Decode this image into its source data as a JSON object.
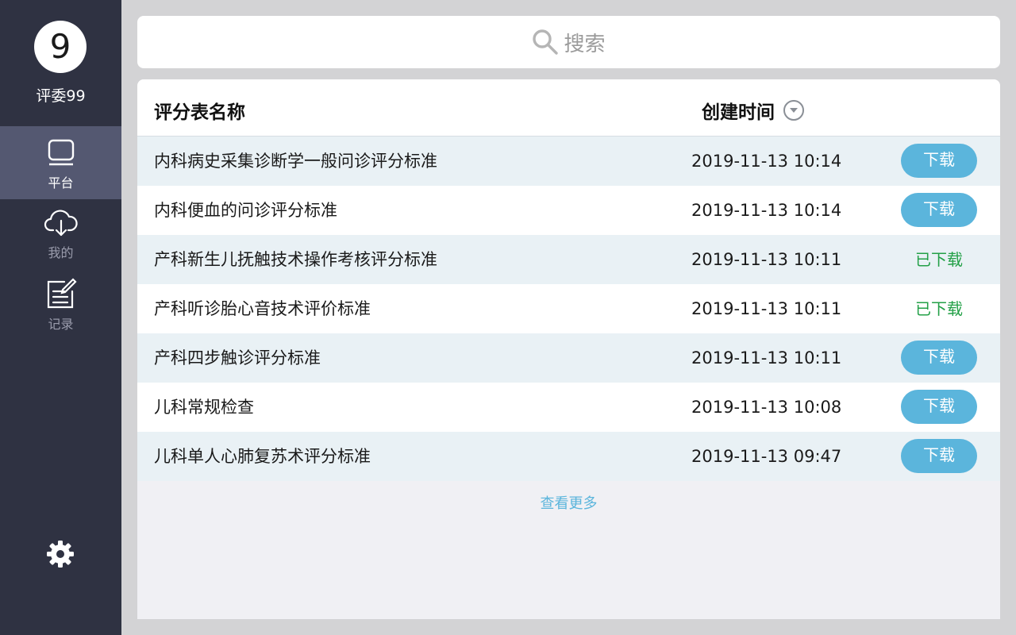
{
  "sidebar": {
    "avatar_text": "9",
    "user_name": "评委99",
    "nav": [
      {
        "label": "平台",
        "icon": "monitor-icon",
        "active": true
      },
      {
        "label": "我的",
        "icon": "cloud-download-icon",
        "active": false
      },
      {
        "label": "记录",
        "icon": "edit-note-icon",
        "active": false
      }
    ],
    "settings_icon": "gear-icon"
  },
  "search": {
    "placeholder": "搜索",
    "icon": "search-icon"
  },
  "table": {
    "headers": {
      "name": "评分表名称",
      "time": "创建时间"
    },
    "rows": [
      {
        "name": "内科病史采集诊断学一般问诊评分标准",
        "time": "2019-11-13 10:14",
        "action": "下载",
        "downloaded": false
      },
      {
        "name": "内科便血的问诊评分标准",
        "time": "2019-11-13 10:14",
        "action": "下载",
        "downloaded": false
      },
      {
        "name": "产科新生儿抚触技术操作考核评分标准",
        "time": "2019-11-13 10:11",
        "action": "已下载",
        "downloaded": true
      },
      {
        "name": "产科听诊胎心音技术评价标准",
        "time": "2019-11-13 10:11",
        "action": "已下载",
        "downloaded": true
      },
      {
        "name": "产科四步触诊评分标准",
        "time": "2019-11-13 10:11",
        "action": "下载",
        "downloaded": false
      },
      {
        "name": "儿科常规检查",
        "time": "2019-11-13 10:08",
        "action": "下载",
        "downloaded": false
      },
      {
        "name": "儿科单人心肺复苏术评分标准",
        "time": "2019-11-13 09:47",
        "action": "下载",
        "downloaded": false
      }
    ],
    "more_label": "查看更多"
  },
  "colors": {
    "sidebar_bg": "#2f3242",
    "sidebar_active": "#545871",
    "accent": "#5bb5dc",
    "downloaded_green": "#23a047",
    "row_alt": "#e9f1f5"
  }
}
